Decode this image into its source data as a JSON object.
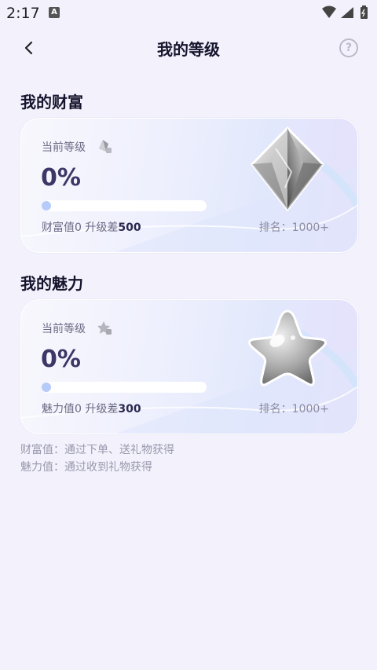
{
  "status_bar": {
    "time": "2:17",
    "indicator": "A"
  },
  "header": {
    "title": "我的等级",
    "back_icon": "back-arrow",
    "help_icon": "help",
    "help_glyph": "?"
  },
  "wealth": {
    "section_title": "我的财富",
    "level_label": "当前等级",
    "percent_text": "0%",
    "progress": 0,
    "value_prefix": "财富值0 升级差",
    "value_gap": "500",
    "rank": "排名：1000+"
  },
  "charm": {
    "section_title": "我的魅力",
    "level_label": "当前等级",
    "percent_text": "0%",
    "progress": 0,
    "value_prefix": "魅力值0 升级差",
    "value_gap": "300",
    "rank": "排名：1000+"
  },
  "notes": [
    "财富值：通过下单、送礼物获得",
    "魅力值：通过收到礼物获得"
  ]
}
